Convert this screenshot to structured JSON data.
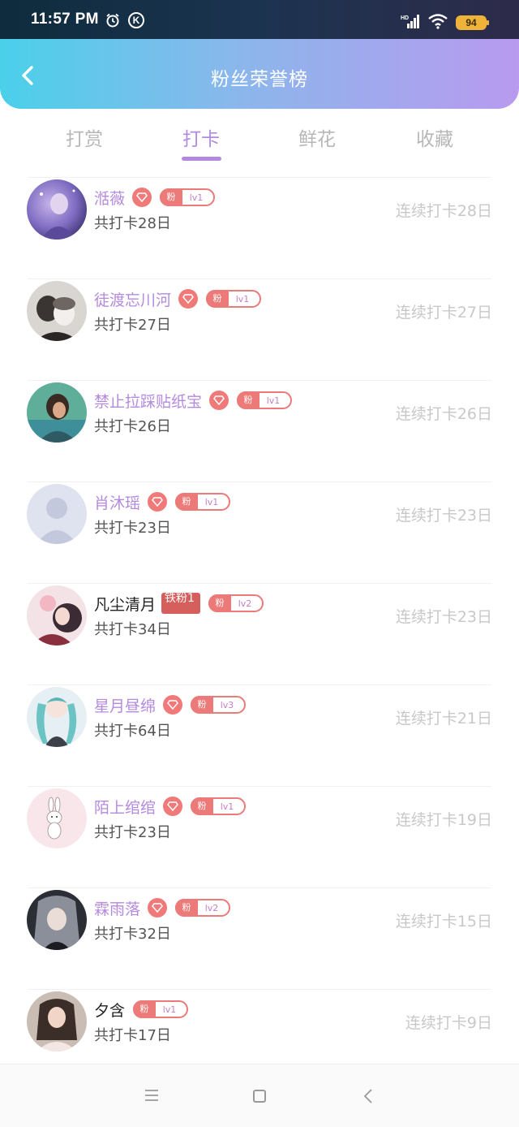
{
  "status_bar": {
    "time": "11:57 PM",
    "k_icon": "K",
    "battery": "94"
  },
  "header": {
    "title": "粉丝荣誉榜"
  },
  "tabs": [
    {
      "label": "打赏",
      "active": false
    },
    {
      "label": "打卡",
      "active": true
    },
    {
      "label": "鲜花",
      "active": false
    },
    {
      "label": "收藏",
      "active": false
    }
  ],
  "rows": [
    {
      "name": "湉薇",
      "diamond": true,
      "badge_left": "粉",
      "badge_level": "lv1",
      "total": "共打卡28日",
      "streak": "连续打卡28日",
      "name_color": "purple"
    },
    {
      "name": "徒渡忘川河",
      "diamond": true,
      "badge_left": "粉",
      "badge_level": "lv1",
      "total": "共打卡27日",
      "streak": "连续打卡27日",
      "name_color": "purple"
    },
    {
      "name": "禁止拉踩贴纸宝",
      "diamond": true,
      "badge_left": "粉",
      "badge_level": "lv1",
      "total": "共打卡26日",
      "streak": "连续打卡26日",
      "name_color": "purple"
    },
    {
      "name": "肖沐瑶",
      "diamond": true,
      "badge_left": "粉",
      "badge_level": "lv1",
      "total": "共打卡23日",
      "streak": "连续打卡23日",
      "name_color": "purple"
    },
    {
      "name": "凡尘清月",
      "tag": "铁粉1",
      "badge_left": "粉",
      "badge_level": "lv2",
      "total": "共打卡34日",
      "streak": "连续打卡23日",
      "name_color": "dark"
    },
    {
      "name": "星月昼绵",
      "diamond": true,
      "badge_left": "粉",
      "badge_level": "lv3",
      "total": "共打卡64日",
      "streak": "连续打卡21日",
      "name_color": "purple"
    },
    {
      "name": "陌上绾绾",
      "diamond": true,
      "badge_left": "粉",
      "badge_level": "lv1",
      "total": "共打卡23日",
      "streak": "连续打卡19日",
      "name_color": "purple"
    },
    {
      "name": "霖雨落",
      "diamond": true,
      "badge_left": "粉",
      "badge_level": "lv2",
      "total": "共打卡32日",
      "streak": "连续打卡15日",
      "name_color": "purple"
    },
    {
      "name": "夕含",
      "diamond": false,
      "badge_left": "粉",
      "badge_level": "lv1",
      "total": "共打卡17日",
      "streak": "连续打卡9日",
      "name_color": "dark"
    }
  ],
  "colors": {
    "accent": "#b48adf",
    "badge": "#ec7a78",
    "tag": "#d55f5d",
    "muted": "#c8c8c8"
  }
}
